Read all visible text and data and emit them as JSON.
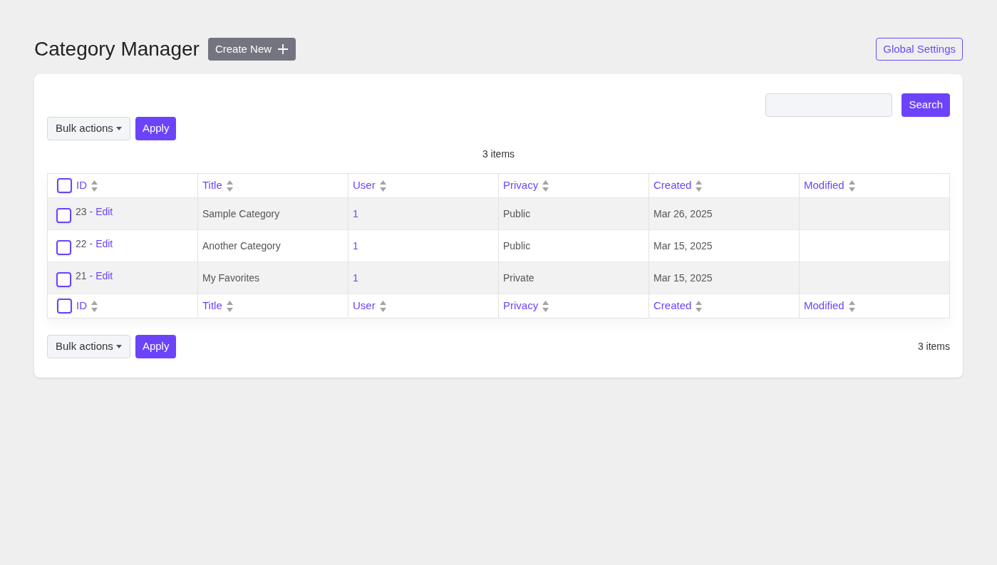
{
  "header": {
    "title": "Category Manager",
    "create_button": "Create New",
    "settings_button": "Global Settings"
  },
  "search": {
    "button": "Search"
  },
  "top_actions": {
    "bulk_label": "Bulk actions",
    "apply": "Apply",
    "count": "3 items"
  },
  "table": {
    "select_all_top": {
      "checked": false
    },
    "select_all_bottom": {
      "checked": false
    },
    "columns": [
      "ID",
      "Title",
      "User",
      "Privacy",
      "Created",
      "Modified"
    ],
    "footer_columns": [
      "ID",
      "Title",
      "User",
      "Privacy",
      "Created",
      "Modified"
    ],
    "rows": [
      {
        "id": "23",
        "edit": "- Edit",
        "title": "Sample Category",
        "user": "1",
        "privacy": "Public",
        "created": "Mar 26, 2025",
        "checked": false
      },
      {
        "id": "22",
        "edit": "- Edit",
        "title": "Another Category",
        "user": "1",
        "privacy": "Public",
        "created": "Mar 15, 2025",
        "checked": false
      },
      {
        "id": "21",
        "edit": "- Edit",
        "title": "My Favorites",
        "user": "1",
        "privacy": "Private",
        "created": "Mar 15, 2025",
        "checked": false
      }
    ]
  },
  "bottom_actions": {
    "bulk_label": "Bulk actions",
    "apply": "Apply",
    "count": "3 items"
  }
}
